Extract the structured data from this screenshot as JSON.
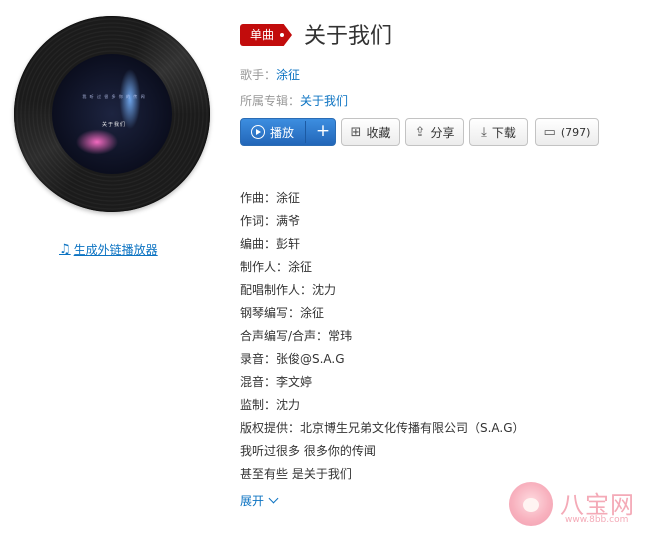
{
  "album_art": {
    "cover_text_line1": "我 听 过 很 多 你 的 传 闻",
    "cover_text_line2": "关于我们"
  },
  "outer_player_link": "生成外链播放器",
  "song": {
    "badge": "单曲",
    "title": "关于我们"
  },
  "meta": {
    "singer_label": "歌手：",
    "singer": "涂征",
    "album_label": "所属专辑：",
    "album": "关于我们"
  },
  "actions": {
    "play": "播放",
    "add": "+",
    "collect": "收藏",
    "share": "分享",
    "download": "下载",
    "comment_count": "(797)"
  },
  "lyrics": [
    "作曲：涂征",
    "作词：满爷",
    "编曲：彭轩",
    "制作人：涂征",
    "配唱制作人：沈力",
    "钢琴编写：涂征",
    "合声编写/合声：常玮",
    "录音：张俊@S.A.G",
    "混音：李文婷",
    "监制：沈力",
    "版权提供：北京博生兄弟文化传播有限公司（S.A.G）",
    "我听过很多 很多你的传闻",
    "甚至有些 是关于我们"
  ],
  "expand_label": "展开",
  "watermark": {
    "title": "八宝网",
    "url": "www.8bb.com"
  },
  "colors": {
    "badge_red": "#c20c0c",
    "link_blue": "#0c73c2",
    "play_blue": "#2266b8"
  }
}
